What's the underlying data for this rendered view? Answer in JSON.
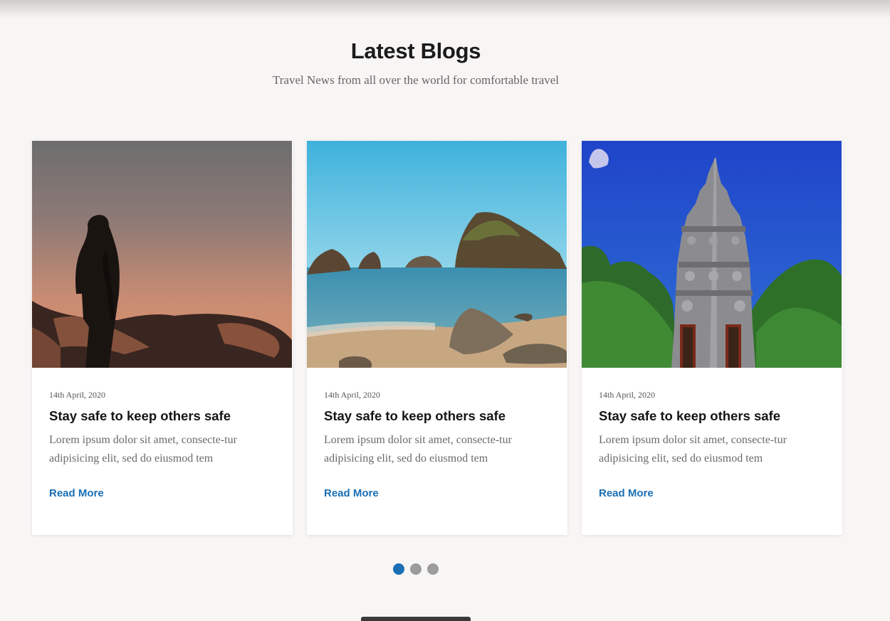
{
  "section": {
    "title": "Latest Blogs",
    "subtitle": "Travel News from all over the world for comfortable travel"
  },
  "cards": [
    {
      "image": "hiker-silhouette-sunset-image",
      "date": "14th April, 2020",
      "title": "Stay safe to keep others safe",
      "excerpt": "Lorem ipsum dolor sit amet, consecte-tur adipisicing elit, sed do eiusmod tem",
      "link": "Read More"
    },
    {
      "image": "rocky-beach-sea-image",
      "date": "14th April, 2020",
      "title": "Stay safe to keep others safe",
      "excerpt": "Lorem ipsum dolor sit amet, consecte-tur adipisicing elit, sed do eiusmod tem",
      "link": "Read More"
    },
    {
      "image": "temple-tower-trees-image",
      "date": "14th April, 2020",
      "title": "Stay safe to keep others safe",
      "excerpt": "Lorem ipsum dolor sit amet, consecte-tur adipisicing elit, sed do eiusmod tem",
      "link": "Read More"
    }
  ],
  "carousel": {
    "slide_count": 3,
    "active_index": 0
  },
  "colors": {
    "accent": "#1a6fb5",
    "background": "#f8f5f5",
    "dot_inactive": "#9c9c9c"
  }
}
